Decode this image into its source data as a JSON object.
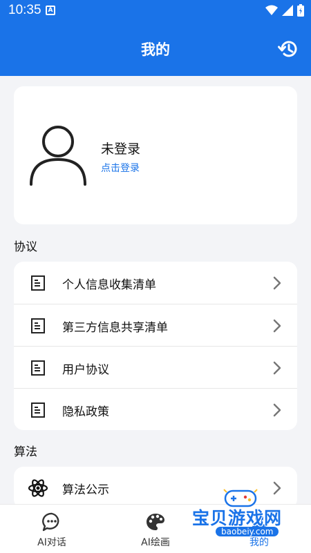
{
  "status_bar": {
    "time": "10:35",
    "notification_letter": "A"
  },
  "header": {
    "title": "我的"
  },
  "profile": {
    "name": "未登录",
    "login_link": "点击登录"
  },
  "sections": {
    "agreements": {
      "title": "协议",
      "items": [
        {
          "label": "个人信息收集清单"
        },
        {
          "label": "第三方信息共享清单"
        },
        {
          "label": "用户协议"
        },
        {
          "label": "隐私政策"
        }
      ]
    },
    "algorithm": {
      "title": "算法",
      "items": [
        {
          "label": "算法公示"
        }
      ]
    }
  },
  "bottom_nav": {
    "items": [
      {
        "label": "AI对话",
        "icon": "chat-icon"
      },
      {
        "label": "AI绘画",
        "icon": "palette-icon"
      },
      {
        "label": "我的",
        "icon": "user-icon",
        "active": true
      }
    ]
  },
  "watermark": {
    "text": "宝贝游戏网",
    "url": "baobeiy.com"
  },
  "colors": {
    "primary": "#1a73e8",
    "background": "#f3f4f7",
    "card": "#ffffff"
  }
}
